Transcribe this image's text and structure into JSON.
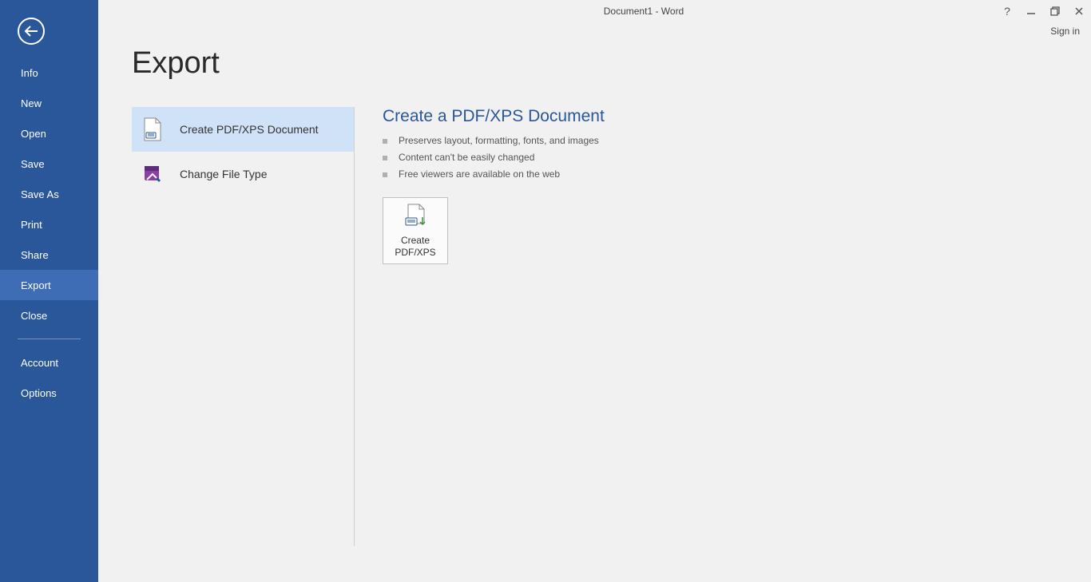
{
  "window": {
    "title": "Document1 - Word",
    "signin": "Sign in"
  },
  "sidebar": {
    "items": [
      {
        "id": "info",
        "label": "Info"
      },
      {
        "id": "new",
        "label": "New"
      },
      {
        "id": "open",
        "label": "Open"
      },
      {
        "id": "save",
        "label": "Save"
      },
      {
        "id": "saveas",
        "label": "Save As"
      },
      {
        "id": "print",
        "label": "Print"
      },
      {
        "id": "share",
        "label": "Share"
      },
      {
        "id": "export",
        "label": "Export"
      },
      {
        "id": "close",
        "label": "Close"
      }
    ],
    "footer": [
      {
        "id": "account",
        "label": "Account"
      },
      {
        "id": "options",
        "label": "Options"
      }
    ],
    "selected": "export"
  },
  "page": {
    "title": "Export",
    "options": [
      {
        "id": "pdfxps",
        "label": "Create PDF/XPS Document"
      },
      {
        "id": "changeft",
        "label": "Change File Type"
      }
    ],
    "selected_option": "pdfxps"
  },
  "detail": {
    "title": "Create a PDF/XPS Document",
    "bullets": [
      "Preserves layout, formatting, fonts, and images",
      "Content can't be easily changed",
      "Free viewers are available on the web"
    ],
    "button_label_line1": "Create",
    "button_label_line2": "PDF/XPS"
  }
}
